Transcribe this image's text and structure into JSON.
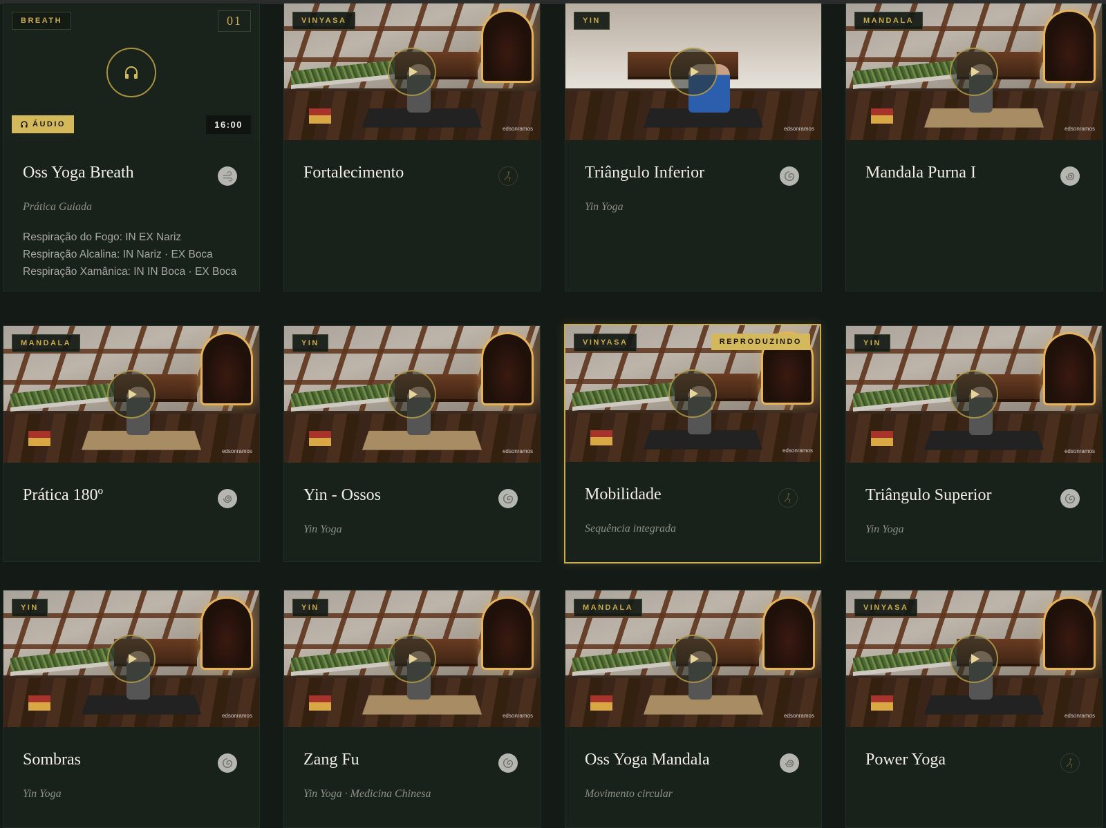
{
  "cards": [
    {
      "tag": "BREATH",
      "number": "01",
      "audio_label": "ÁUDIO",
      "duration": "16:00",
      "title": "Oss Yoga Breath",
      "subtitle": "Prática Guiada",
      "desc": [
        "Respiração do Fogo: IN EX Nariz",
        "Respiração Alcalina: IN Nariz · EX Boca",
        "Respiração Xamânica: IN IN Boca · EX Boca"
      ],
      "icon": "wind-swirl-icon"
    },
    {
      "tag": "VINYASA",
      "title": "Fortalecimento",
      "icon": "vinyasa-figure-icon"
    },
    {
      "tag": "YIN",
      "title": "Triângulo Inferior",
      "subtitle": "Yin Yoga",
      "icon": "yin-swirl-icon"
    },
    {
      "tag": "MANDALA",
      "title": "Mandala Purna I",
      "icon": "mandala-spiral-icon"
    },
    {
      "tag": "MANDALA",
      "title": "Prática 180º",
      "icon": "mandala-spiral-icon"
    },
    {
      "tag": "YIN",
      "title": "Yin - Ossos",
      "subtitle": "Yin Yoga",
      "icon": "yin-swirl-icon"
    },
    {
      "tag": "VINYASA",
      "title": "Mobilidade",
      "subtitle": "Sequência integrada",
      "playing_label": "REPRODUZINDO",
      "icon": "vinyasa-figure-icon"
    },
    {
      "tag": "YIN",
      "title": "Triângulo Superior",
      "subtitle": "Yin Yoga",
      "icon": "yin-swirl-icon"
    },
    {
      "tag": "YIN",
      "title": "Sombras",
      "subtitle": "Yin Yoga",
      "icon": "yin-swirl-icon"
    },
    {
      "tag": "YIN",
      "title": "Zang Fu",
      "subtitle": "Yin Yoga · Medicina Chinesa",
      "icon": "yin-swirl-icon"
    },
    {
      "tag": "MANDALA",
      "title": "Oss Yoga Mandala",
      "subtitle": "Movimento circular",
      "icon": "mandala-spiral-icon"
    },
    {
      "tag": "VINYASA",
      "title": "Power Yoga",
      "icon": "vinyasa-figure-icon"
    }
  ],
  "thumb_logo": "edsonramos",
  "colors": {
    "background": "#141a16",
    "card": "#19211b",
    "accent": "#c9ac4e",
    "badge": "#d4b95c"
  }
}
